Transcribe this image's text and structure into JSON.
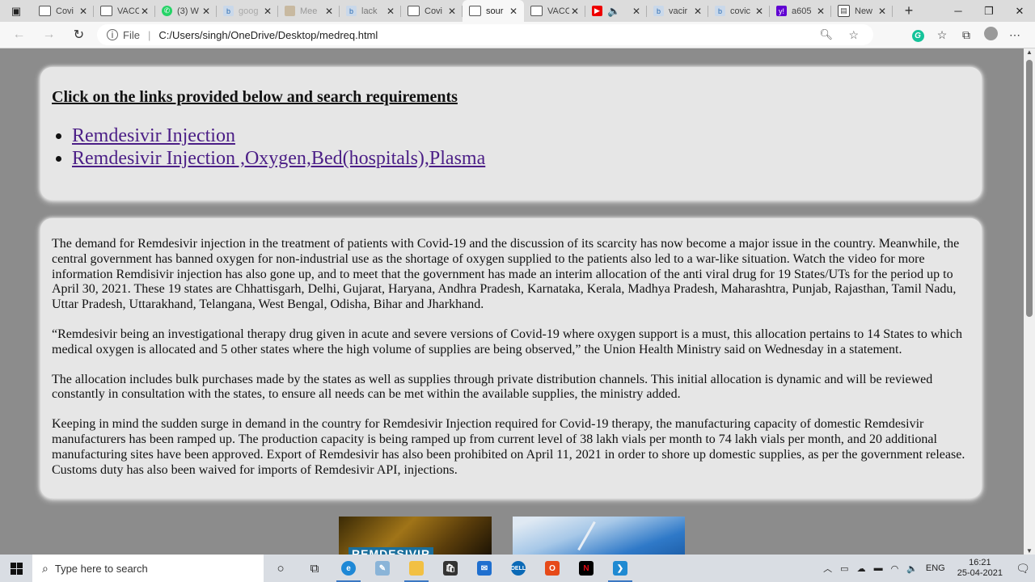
{
  "browser": {
    "tabs": [
      {
        "title": "Covi",
        "icon": "page"
      },
      {
        "title": "VACC",
        "icon": "page"
      },
      {
        "title": "(3) W",
        "icon": "whatsapp"
      },
      {
        "title": "goog",
        "icon": "bing"
      },
      {
        "title": "Mee",
        "icon": "image"
      },
      {
        "title": "lack",
        "icon": "bing"
      },
      {
        "title": "Covi",
        "icon": "page"
      },
      {
        "title": "sour",
        "icon": "page",
        "active": true
      },
      {
        "title": "VACC",
        "icon": "page"
      },
      {
        "title": "",
        "icon": "youtube"
      },
      {
        "title": "vacir",
        "icon": "bing"
      },
      {
        "title": "covic",
        "icon": "bing"
      },
      {
        "title": "a605",
        "icon": "yahoo"
      },
      {
        "title": "New",
        "icon": "newtab"
      }
    ],
    "address": {
      "scheme_label": "File",
      "url": "C:/Users/singh/OneDrive/Desktop/medreq.html"
    }
  },
  "page": {
    "heading": "Click on the links provided below and search requirements",
    "links": [
      "Remdesivir Injection",
      "Remdesivir Injection ,Oxygen,Bed(hospitals),Plasma"
    ],
    "paragraphs": [
      "The demand for Remdesivir injection in the treatment of patients with Covid-19 and the discussion of its scarcity has now become a major issue in the country. Meanwhile, the central government has banned oxygen for non-industrial use as the shortage of oxygen supplied to the patients also led to a war-like situation. Watch the video for more information Remdisivir injection has also gone up, and to meet that the government has made an interim allocation of the anti viral drug for 19 States/UTs for the period up to April 30, 2021. These 19 states are Chhattisgarh, Delhi, Gujarat, Haryana, Andhra Pradesh, Karnataka, Kerala, Madhya Pradesh, Maharashtra, Punjab, Rajasthan, Tamil Nadu, Uttar Pradesh, Uttarakhand, Telangana, West Bengal, Odisha, Bihar and Jharkhand.",
      "“Remdesivir being an investigational therapy drug given in acute and severe versions of Covid-19 where oxygen support is a must, this allocation pertains to 14 States to which medical oxygen is allocated and 5 other states where the high volume of supplies are being observed,” the Union Health Ministry said on Wednesday in a statement.",
      "The allocation includes bulk purchases made by the states as well as supplies through private distribution channels. This initial allocation is dynamic and will be reviewed constantly in consultation with the states, to ensure all needs can be met within the available supplies, the ministry added.",
      "Keeping in mind the sudden surge in demand in the country for Remdesivir Injection required for Covid-19 therapy, the manufacturing capacity of domestic Remdesivir manufacturers has been ramped up. The production capacity is being ramped up from current level of 38 lakh vials per month to 74 lakh vials per month, and 20 additional manufacturing sites have been approved. Export of Remdesivir has also been prohibited on April 11, 2021 in order to shore up domestic supplies, as per the government release. Customs duty has also been waived for imports of Remdesivir API, injections."
    ],
    "image1_text": "REMDESIVIR"
  },
  "taskbar": {
    "search_placeholder": "Type here to search",
    "language": "ENG",
    "time": "16:21",
    "date": "25-04-2021"
  }
}
